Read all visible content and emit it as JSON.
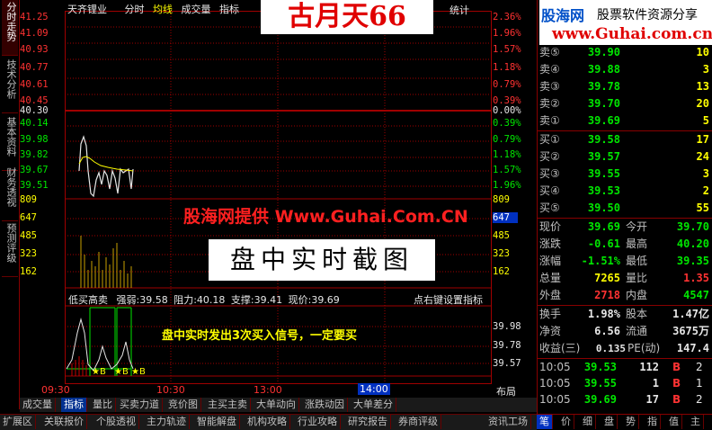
{
  "left_tabs": [
    "分时走势",
    "技术分析",
    "基本资料",
    "财务透视",
    "预测评级"
  ],
  "toolbar": {
    "stock_name": "天齐锂业",
    "items": [
      "分时",
      "均线",
      "成交量",
      "指标"
    ],
    "stats": "统计"
  },
  "watermark_title": "古月天66",
  "logo": {
    "name": "股海网",
    "slogan": "股票软件资源分享",
    "url": "www.Guhai.com.cn"
  },
  "banner_provided": "股海网提供 Www.Guhai.Com.CN",
  "banner_intraday": "盘中实时截图",
  "price_axis": {
    "left": [
      "41.25",
      "41.09",
      "40.93",
      "40.77",
      "40.61",
      "40.45",
      "40.30",
      "40.14",
      "39.98",
      "39.82",
      "39.67",
      "39.51"
    ],
    "right": [
      "2.36%",
      "1.96%",
      "1.57%",
      "1.18%",
      "0.79%",
      "0.39%",
      "0.00%",
      "0.39%",
      "0.79%",
      "1.18%",
      "1.57%",
      "1.96%"
    ]
  },
  "volume_axis": {
    "left": [
      "809",
      "647",
      "485",
      "323",
      "162"
    ],
    "right": [
      "809",
      "485",
      "323",
      "162"
    ],
    "marker": "647"
  },
  "indicator_line": {
    "name": "低买高卖",
    "strength": "强弱:39.58",
    "resistance": "阻力:40.18",
    "support": "支撑:39.41",
    "current": "现价:39.69",
    "settings": "点右键设置指标"
  },
  "indicator_axis": [
    "39.98",
    "39.78",
    "39.57"
  ],
  "signal_text": "盘中实时发出3次买入信号，一定要买",
  "signal_marks": [
    "★B",
    "★B",
    "★B"
  ],
  "time_axis": [
    "09:30",
    "10:30",
    "13:00",
    "14:00"
  ],
  "layout_label": "布局",
  "order_book": {
    "sells": [
      {
        "label": "卖⑤",
        "price": "39.90",
        "vol": "10"
      },
      {
        "label": "卖④",
        "price": "39.88",
        "vol": "3"
      },
      {
        "label": "卖③",
        "price": "39.78",
        "vol": "13"
      },
      {
        "label": "卖②",
        "price": "39.70",
        "vol": "20"
      },
      {
        "label": "卖①",
        "price": "39.69",
        "vol": "5"
      }
    ],
    "buys": [
      {
        "label": "买①",
        "price": "39.58",
        "vol": "17"
      },
      {
        "label": "买②",
        "price": "39.57",
        "vol": "24"
      },
      {
        "label": "买③",
        "price": "39.55",
        "vol": "3"
      },
      {
        "label": "买④",
        "price": "39.53",
        "vol": "2"
      },
      {
        "label": "买⑤",
        "price": "39.50",
        "vol": "55"
      }
    ]
  },
  "quote": [
    {
      "l1": "现价",
      "v1": "39.69",
      "l2": "今开",
      "v2": "39.70"
    },
    {
      "l1": "涨跌",
      "v1": "-0.61",
      "l2": "最高",
      "v2": "40.20"
    },
    {
      "l1": "涨幅",
      "v1": "-1.51%",
      "l2": "最低",
      "v2": "39.35"
    },
    {
      "l1": "总量",
      "v1": "7265",
      "l2": "量比",
      "v2": "1.35"
    },
    {
      "l1": "外盘",
      "v1": "2718",
      "l2": "内盘",
      "v2": "4547"
    }
  ],
  "stats": [
    {
      "l1": "换手",
      "v1": "1.98%",
      "l2": "股本",
      "v2": "1.47亿"
    },
    {
      "l1": "净资",
      "v1": "6.56",
      "l2": "流通",
      "v2": "3675万"
    },
    {
      "l1": "收益(三)",
      "v1": "0.135",
      "l2": "PE(动)",
      "v2": "147.4"
    }
  ],
  "ticks": [
    {
      "time": "10:05",
      "price": "39.53",
      "vol": "112",
      "side": "B",
      "n": "2"
    },
    {
      "time": "10:05",
      "price": "39.55",
      "vol": "1",
      "side": "B",
      "n": "1"
    },
    {
      "time": "10:05",
      "price": "39.69",
      "vol": "17",
      "side": "B",
      "n": "2"
    }
  ],
  "right_tabs": [
    "笔",
    "价",
    "细",
    "盘",
    "势",
    "指",
    "值",
    "主"
  ],
  "bottom_tabs_1": [
    "成交量",
    "指标",
    "量比",
    "买卖力道",
    "竞价图",
    "主买主卖",
    "大单动向",
    "涨跌动因",
    "大单差分"
  ],
  "bottom_tabs_2": [
    "扩展区",
    "关联报价",
    "个股透视",
    "主力轨迹",
    "智能解盘",
    "机构攻略",
    "行业攻略",
    "研究报告",
    "券商评级"
  ],
  "bottom_right": "资讯工场",
  "colors": {
    "up": "#ff3232",
    "down": "#00e600",
    "grid": "#a00000",
    "avg": "#ffff00"
  }
}
